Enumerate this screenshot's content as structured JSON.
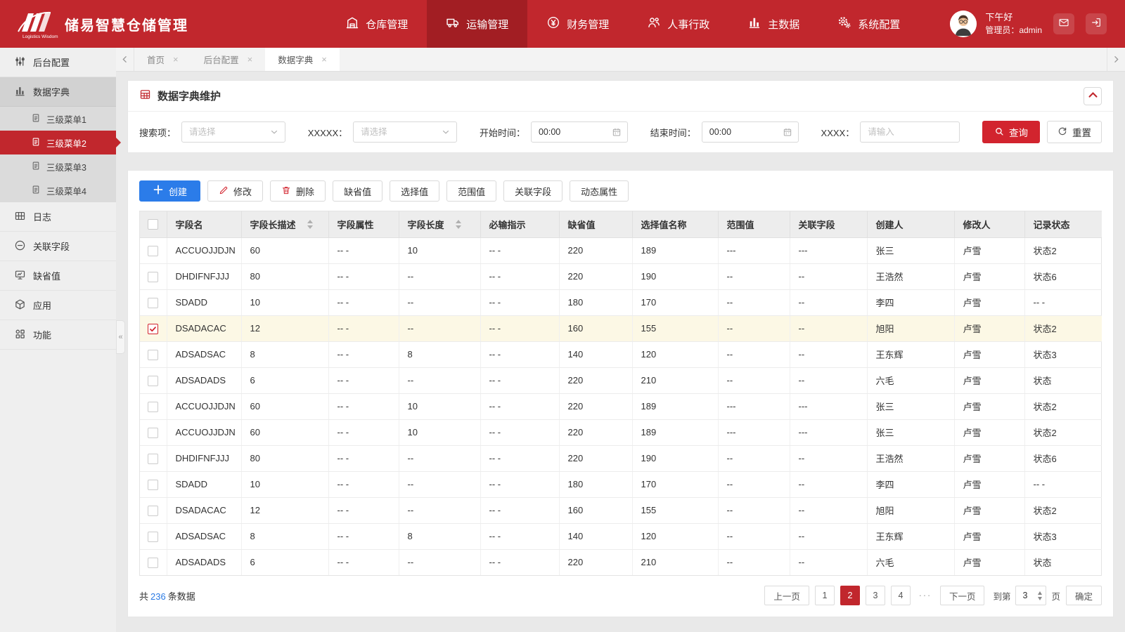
{
  "colors": {
    "header_red": "#c1272d",
    "header_active_red": "#a21e23",
    "query_red": "#d2242e",
    "primary_blue": "#2b7ce9",
    "count_blue": "#2a7ae4",
    "checked_row_bg": "#fcf8e5"
  },
  "header": {
    "logo_subtext": "Logistics Wisdom",
    "app_title": "储易智慧仓储管理",
    "nav": [
      {
        "key": "warehouse",
        "icon": "warehouse-icon",
        "label": "仓库管理",
        "active": false
      },
      {
        "key": "transport",
        "icon": "truck-icon",
        "label": "运输管理",
        "active": true
      },
      {
        "key": "finance",
        "icon": "finance-icon",
        "label": "财务管理",
        "active": false
      },
      {
        "key": "hr",
        "icon": "hr-icon",
        "label": "人事行政",
        "active": false
      },
      {
        "key": "master-data",
        "icon": "bar-chart-icon",
        "label": "主数据",
        "active": false
      },
      {
        "key": "system-config",
        "icon": "gears-icon",
        "label": "系统配置",
        "active": false
      }
    ],
    "greeting": "下午好",
    "role_line": "管理员：admin"
  },
  "sidebar": {
    "items": [
      {
        "key": "backend-config",
        "icon": "sliders-icon",
        "label": "后台配置"
      },
      {
        "key": "data-dictionary",
        "icon": "chart-icon",
        "label": "数据字典",
        "expanded": true,
        "children": [
          {
            "key": "submenu-1",
            "label": "三级菜单1",
            "active": false
          },
          {
            "key": "submenu-2",
            "label": "三级菜单2",
            "active": true
          },
          {
            "key": "submenu-3",
            "label": "三级菜单3",
            "active": false
          },
          {
            "key": "submenu-4",
            "label": "三级菜单4",
            "active": false
          }
        ]
      },
      {
        "key": "logs",
        "icon": "grid-icon",
        "label": "日志"
      },
      {
        "key": "linked-fields",
        "icon": "link-icon",
        "label": "关联字段"
      },
      {
        "key": "default-values",
        "icon": "monitor-icon",
        "label": "缺省值"
      },
      {
        "key": "applications",
        "icon": "cube-icon",
        "label": "应用"
      },
      {
        "key": "functions",
        "icon": "dots-grid-icon",
        "label": "功能"
      }
    ],
    "collapse_glyph": "«"
  },
  "tabs": [
    {
      "key": "home",
      "label": "首页",
      "active": false
    },
    {
      "key": "backend-config",
      "label": "后台配置",
      "active": false
    },
    {
      "key": "data-dictionary",
      "label": "数据字典",
      "active": true
    }
  ],
  "panel": {
    "title": "数据字典维护"
  },
  "filters": {
    "search_label": "搜索项：",
    "search_placeholder": "请选择",
    "xxxxx_label": "XXXXX：",
    "xxxxx_placeholder": "请选择",
    "start_time_label": "开始时间：",
    "start_time_value": "00:00",
    "end_time_label": "结束时间：",
    "end_time_value": "00:00",
    "xxxx_label": "XXXX：",
    "xxxx_placeholder": "请输入",
    "query_button": "查询",
    "reset_button": "重置"
  },
  "toolbar": [
    {
      "key": "create",
      "label": "创建",
      "icon": "plus-icon",
      "style": "primary"
    },
    {
      "key": "edit",
      "label": "修改",
      "icon": "pencil-icon"
    },
    {
      "key": "delete",
      "label": "删除",
      "icon": "trash-icon"
    },
    {
      "key": "default-value",
      "label": "缺省值"
    },
    {
      "key": "select-value",
      "label": "选择值"
    },
    {
      "key": "range-value",
      "label": "范围值"
    },
    {
      "key": "linked-field",
      "label": "关联字段"
    },
    {
      "key": "dynamic-attr",
      "label": "动态属性"
    }
  ],
  "table": {
    "columns": [
      {
        "label": "字段名",
        "sortable": false
      },
      {
        "label": "字段长描述",
        "sortable": true
      },
      {
        "label": "字段属性",
        "sortable": false
      },
      {
        "label": "字段长度",
        "sortable": true
      },
      {
        "label": "必输指示",
        "sortable": false
      },
      {
        "label": "缺省值",
        "sortable": false
      },
      {
        "label": "选择值名称",
        "sortable": false
      },
      {
        "label": "范围值",
        "sortable": false
      },
      {
        "label": "关联字段",
        "sortable": false
      },
      {
        "label": "创建人",
        "sortable": false
      },
      {
        "label": "修改人",
        "sortable": false
      },
      {
        "label": "记录状态",
        "sortable": false
      }
    ],
    "rows": [
      {
        "checked": false,
        "cells": [
          "ACCUOJJDJN",
          "60",
          "-- -",
          "10",
          "-- -",
          "220",
          "189",
          "---",
          "---",
          "张三",
          "卢雪",
          "状态2"
        ]
      },
      {
        "checked": false,
        "cells": [
          "DHDIFNFJJJ",
          "80",
          "-- -",
          "--",
          "-- -",
          "220",
          "190",
          "--",
          "--",
          "王浩然",
          "卢雪",
          "状态6"
        ]
      },
      {
        "checked": false,
        "cells": [
          "SDADD",
          "10",
          "-- -",
          "--",
          "-- -",
          "180",
          "170",
          "--",
          "--",
          "李四",
          "卢雪",
          "-- -"
        ]
      },
      {
        "checked": true,
        "cells": [
          "DSADACAC",
          "12",
          "-- -",
          "--",
          "-- -",
          "160",
          "155",
          "--",
          "--",
          "旭阳",
          "卢雪",
          "状态2"
        ]
      },
      {
        "checked": false,
        "cells": [
          "ADSADSAC",
          "8",
          "-- -",
          "8",
          "-- -",
          "140",
          "120",
          "--",
          "--",
          "王东辉",
          "卢雪",
          "状态3"
        ]
      },
      {
        "checked": false,
        "cells": [
          "ADSADADS",
          "6",
          "-- -",
          "--",
          "-- -",
          "220",
          "210",
          "--",
          "--",
          "六毛",
          "卢雪",
          "状态"
        ]
      },
      {
        "checked": false,
        "cells": [
          "ACCUOJJDJN",
          "60",
          "-- -",
          "10",
          "-- -",
          "220",
          "189",
          "---",
          "---",
          "张三",
          "卢雪",
          "状态2"
        ]
      },
      {
        "checked": false,
        "cells": [
          "ACCUOJJDJN",
          "60",
          "-- -",
          "10",
          "-- -",
          "220",
          "189",
          "---",
          "---",
          "张三",
          "卢雪",
          "状态2"
        ]
      },
      {
        "checked": false,
        "cells": [
          "DHDIFNFJJJ",
          "80",
          "-- -",
          "--",
          "-- -",
          "220",
          "190",
          "--",
          "--",
          "王浩然",
          "卢雪",
          "状态6"
        ]
      },
      {
        "checked": false,
        "cells": [
          "SDADD",
          "10",
          "-- -",
          "--",
          "-- -",
          "180",
          "170",
          "--",
          "--",
          "李四",
          "卢雪",
          "-- -"
        ]
      },
      {
        "checked": false,
        "cells": [
          "DSADACAC",
          "12",
          "-- -",
          "--",
          "-- -",
          "160",
          "155",
          "--",
          "--",
          "旭阳",
          "卢雪",
          "状态2"
        ]
      },
      {
        "checked": false,
        "cells": [
          "ADSADSAC",
          "8",
          "-- -",
          "8",
          "-- -",
          "140",
          "120",
          "--",
          "--",
          "王东辉",
          "卢雪",
          "状态3"
        ]
      },
      {
        "checked": false,
        "cells": [
          "ADSADADS",
          "6",
          "-- -",
          "--",
          "-- -",
          "220",
          "210",
          "--",
          "--",
          "六毛",
          "卢雪",
          "状态"
        ]
      }
    ]
  },
  "footer": {
    "total_prefix": "共",
    "total_count": "236",
    "total_suffix": "条数据",
    "pagination": {
      "prev": "上一页",
      "pages": [
        "1",
        "2",
        "3",
        "4"
      ],
      "active_page": "2",
      "ellipsis": "···",
      "next": "下一页",
      "goto_prefix": "到第",
      "goto_value": "3",
      "goto_suffix": "页",
      "confirm": "确定"
    }
  }
}
